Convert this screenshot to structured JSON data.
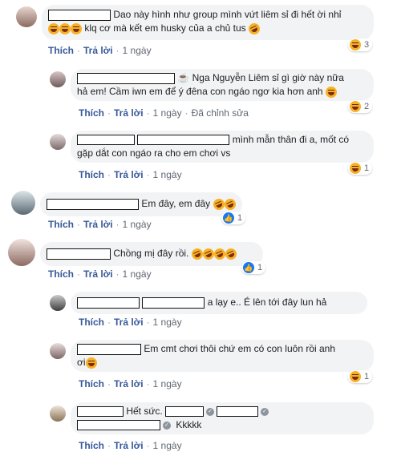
{
  "comments": [
    {
      "text": "Dao này hình như group mình vứt liêm sỉ đi hết ời nhỉ",
      "text2": "klq cơ mà kết em husky của a chủ tus",
      "like": "Thích",
      "reply": "Trả lời",
      "time": "1 ngày",
      "reaction_count": "3"
    },
    {
      "text_prefix": "☕ Nga Nguyễn Liêm sỉ gì giờ này nữa",
      "text2": "hả em! Cầm iwn em để ý đêna con ngáo ngơ kia hơn anh",
      "like": "Thích",
      "reply": "Trả lời",
      "time": "1 ngày",
      "edited": "Đã chỉnh sửa",
      "reaction_count": "2"
    },
    {
      "text": "mình mẫn thân đi a, mốt có",
      "text2": "gặp dắt con ngáo ra cho em chơi vs",
      "like": "Thích",
      "reply": "Trả lời",
      "time": "1 ngày",
      "reaction_count": "1"
    },
    {
      "text": "Em đây, em đây",
      "like": "Thích",
      "reply": "Trả lời",
      "time": "1 ngày",
      "reaction_count": "1"
    },
    {
      "text": "Chồng mị đây rồi.",
      "like": "Thích",
      "reply": "Trả lời",
      "time": "1 ngày",
      "reaction_count": "1"
    },
    {
      "text": "a lạy e.. É lên tới đây lun hả",
      "like": "Thích",
      "reply": "Trả lời",
      "time": "1 ngày"
    },
    {
      "text": "Em cmt chơi thôi chứ em có con luôn rồi anh",
      "text2": "ơi",
      "like": "Thích",
      "reply": "Trả lời",
      "time": "1 ngày",
      "reaction_count": "1"
    },
    {
      "text": "Hết sức.",
      "text2": "Kkkkk",
      "like": "Thích",
      "reply": "Trả lời",
      "time": "1 ngày"
    }
  ],
  "colors": {
    "link": "#385898",
    "bubble": "#f2f3f5",
    "like": "#1877f2",
    "emoji": "#f7b125"
  },
  "icons": [
    "laughing-emoji-icon",
    "rofl-emoji-icon",
    "like-reaction-icon",
    "coffee-icon",
    "verified-icon"
  ]
}
